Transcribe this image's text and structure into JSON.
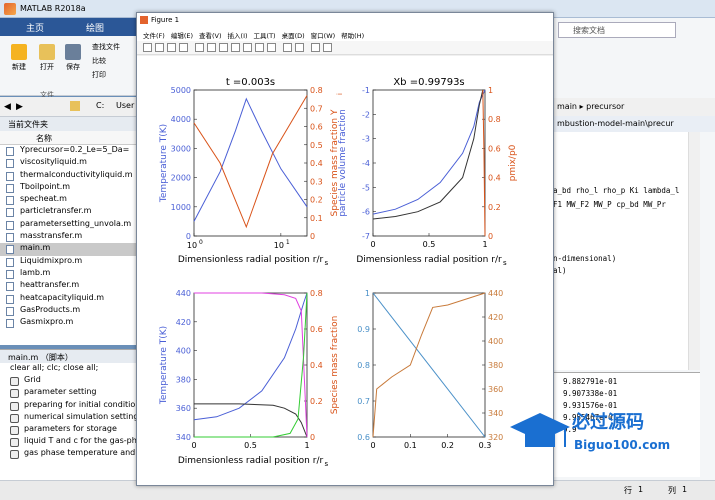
{
  "main": {
    "title": "MATLAB R2018a",
    "tabs": [
      "主页",
      "绘图"
    ],
    "ribbon": {
      "new_label": "新建",
      "open_label": "打开",
      "save_label": "保存",
      "find_files_label": "查找文件",
      "compare_label": "比较",
      "print_label": "打印",
      "file_section_label": "文件"
    },
    "path_prefix": "C:",
    "path_folder": "User",
    "current_folder_label": "当前文件夹",
    "name_column": "名称",
    "files": [
      "Yprecursor=0.2_Le=5_Da=",
      "viscosityliquid.m",
      "thermalconductivityliquid.m",
      "Tboilpoint.m",
      "specheat.m",
      "particletransfer.m",
      "parametersetting_unvola.m",
      "masstransfer.m",
      "main.m",
      "Liquidmixpro.m",
      "lamb.m",
      "heattransfer.m",
      "heatcapacityliquid.m",
      "GasProducts.m",
      "Gasmixpro.m"
    ],
    "selected_file_index": 8,
    "details_header": "main.m （脚本）",
    "details": [
      "clear all; clc; close all;",
      "Grid",
      "parameter setting",
      "preparing for initial conditio",
      "numerical simulation setting",
      "parameters for storage",
      "liquid T and c for the gas-ph",
      "gas phase temperature and"
    ],
    "search_placeholder": "搜索文档",
    "editor_breadcrumb_1": "main",
    "editor_breadcrumb_2": "precursor",
    "editor_tab": "mbustion-model-main\\precur",
    "editor_lines": [
      "a_bd rho_l rho_p Ki lambda_l",
      "F1 MW_F2 MW_P cp_bd MW_Pr",
      "n-dimensional)",
      "al)"
    ],
    "cmd_lines": [
      "9.882791e-01",
      "9.907338e-01",
      "9.931576e-01",
      "9.955467e-01",
      "9.9"
    ],
    "status_row_label": "行",
    "status_row": "1",
    "status_col_label": "列",
    "status_col": "1"
  },
  "figure": {
    "title": "Figure 1",
    "menu": [
      "文件(F)",
      "编辑(E)",
      "查看(V)",
      "插入(I)",
      "工具(T)",
      "桌面(D)",
      "窗口(W)",
      "帮助(H)"
    ]
  },
  "colors": {
    "blue": "#4a5fd6",
    "orange": "#d95319",
    "dark": "#333333",
    "pink": "#e040e0",
    "green": "#33cc33",
    "steelblue": "#4a90c8",
    "brown": "#c87a3a"
  },
  "chart_data": [
    {
      "type": "line",
      "title": "t =0.003s",
      "xlabel": "Dimensionless radial position r/r",
      "xlabel_sub": "s",
      "ylabel_left": "Temperature T(K)",
      "ylabel_right": "Species mass fraction Y",
      "ylabel_right_sub": "i",
      "xscale": "log",
      "xlim": [
        1,
        20
      ],
      "ylim_left": [
        0,
        5000
      ],
      "ylim_right": [
        0,
        0.8
      ],
      "xtick_labels": [
        "10",
        "0",
        "10",
        "1"
      ],
      "yticks_left": [
        0,
        1000,
        2000,
        3000,
        4000,
        5000
      ],
      "yticks_right": [
        0,
        0.1,
        0.2,
        0.3,
        0.4,
        0.5,
        0.6,
        0.7,
        0.8
      ],
      "series": [
        {
          "axis": "left",
          "x": [
            1,
            2,
            3,
            4,
            6,
            10,
            20
          ],
          "y": [
            500,
            2200,
            3600,
            4700,
            3600,
            2300,
            1000
          ],
          "color": "#4a5fd6"
        },
        {
          "axis": "right",
          "x": [
            1,
            2,
            4,
            4,
            8,
            20
          ],
          "y": [
            0.62,
            0.4,
            0.05,
            0.05,
            0.45,
            0.77
          ],
          "color": "#d95319"
        }
      ]
    },
    {
      "type": "line",
      "title": "Xb =0.99793s",
      "xlabel": "Dimensionless radial position r/r",
      "xlabel_sub": "s",
      "ylabel_left": "particle volume fraction",
      "ylabel_right": "pmix/p0",
      "xlim": [
        0,
        1
      ],
      "ylim_left": [
        -7,
        -1
      ],
      "ylim_right": [
        0,
        1
      ],
      "xticks": [
        0,
        0.5,
        1
      ],
      "yticks_left": [
        -7,
        -6,
        -5,
        -4,
        -3,
        -2,
        -1
      ],
      "yticks_right": [
        0,
        0.2,
        0.4,
        0.6,
        0.8,
        1
      ],
      "series": [
        {
          "axis": "left",
          "x": [
            0,
            0.2,
            0.4,
            0.6,
            0.8,
            0.9,
            0.95,
            1
          ],
          "y": [
            -6.1,
            -5.9,
            -5.5,
            -4.8,
            -3.6,
            -2.5,
            -1.5,
            -1
          ],
          "color": "#4a5fd6"
        },
        {
          "axis": "left",
          "x": [
            0,
            0.2,
            0.4,
            0.6,
            0.8,
            0.9,
            0.95,
            0.98
          ],
          "y": [
            -6.3,
            -6.2,
            -6.0,
            -5.6,
            -4.6,
            -3.0,
            -1.6,
            -1
          ],
          "color": "#333333"
        },
        {
          "axis": "right",
          "x": [
            0.98,
            0.99,
            1
          ],
          "y": [
            1,
            0.6,
            0
          ],
          "color": "#d95319"
        }
      ]
    },
    {
      "type": "line",
      "title": "",
      "xlabel": "Dimensionless radial position r/r",
      "xlabel_sub": "s",
      "ylabel_left": "Temperature T(K)",
      "ylabel_right": "Species mass fraction",
      "xlim": [
        0,
        1
      ],
      "ylim_left": [
        340,
        440
      ],
      "ylim_right": [
        0,
        0.8
      ],
      "xticks": [
        0,
        0.5,
        1
      ],
      "yticks_left": [
        340,
        360,
        380,
        400,
        420,
        440
      ],
      "yticks_right": [
        0,
        0.2,
        0.4,
        0.6,
        0.8
      ],
      "series": [
        {
          "axis": "left",
          "x": [
            0,
            0.2,
            0.4,
            0.6,
            0.8,
            0.9,
            0.97,
            1
          ],
          "y": [
            352,
            354,
            360,
            372,
            395,
            415,
            433,
            440
          ],
          "color": "#4a5fd6"
        },
        {
          "axis": "left",
          "x": [
            0,
            0.4,
            0.7,
            0.8,
            0.9,
            0.95,
            1
          ],
          "y": [
            363,
            363,
            362,
            360,
            356,
            350,
            340
          ],
          "color": "#333333"
        },
        {
          "axis": "right",
          "x": [
            0,
            0.6,
            0.8,
            0.9,
            0.95,
            1
          ],
          "y": [
            0.8,
            0.8,
            0.79,
            0.77,
            0.7,
            0.0
          ],
          "color": "#e040e0"
        },
        {
          "axis": "right",
          "x": [
            0,
            0.7,
            0.85,
            0.92,
            0.97,
            1
          ],
          "y": [
            0,
            0,
            0.02,
            0.1,
            0.45,
            0.8
          ],
          "color": "#33cc33"
        }
      ]
    },
    {
      "type": "line",
      "title": "",
      "xlabel": "",
      "xlim": [
        0,
        0.3
      ],
      "ylim_left": [
        0.6,
        1
      ],
      "ylim_right": [
        320,
        440
      ],
      "xticks": [
        0,
        0.1,
        0.2,
        0.3
      ],
      "yticks_left": [
        0.6,
        0.7,
        0.8,
        0.9,
        1
      ],
      "yticks_right": [
        320,
        340,
        360,
        380,
        400,
        420,
        440
      ],
      "series": [
        {
          "axis": "left",
          "x": [
            0,
            0.3
          ],
          "y": [
            1,
            0.6
          ],
          "color": "#4a90c8"
        },
        {
          "axis": "right",
          "x": [
            0,
            0.01,
            0.05,
            0.1,
            0.13,
            0.16,
            0.2,
            0.3
          ],
          "y": [
            320,
            360,
            370,
            380,
            405,
            428,
            430,
            440
          ],
          "color": "#c87a3a"
        }
      ]
    }
  ]
}
